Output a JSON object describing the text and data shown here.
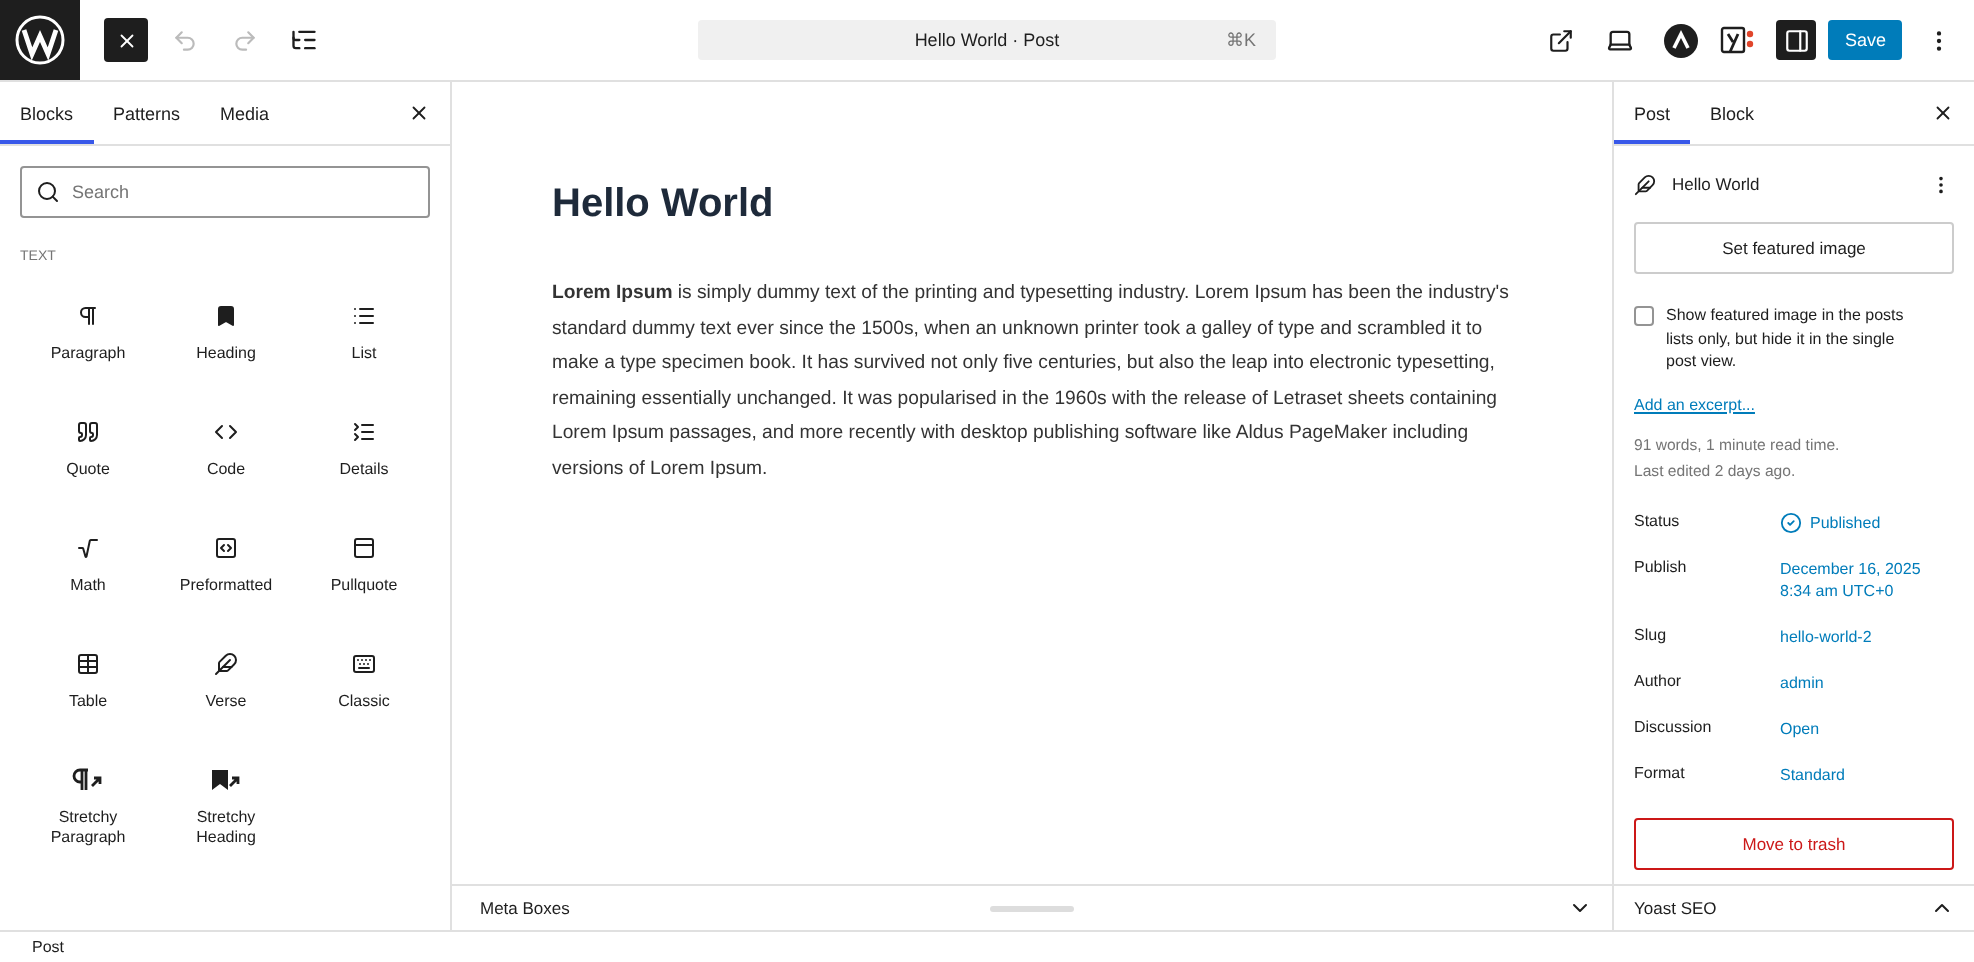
{
  "toolbar": {
    "command_bar": {
      "title": "Hello World · Post",
      "shortcut": "⌘K"
    },
    "save_label": "Save"
  },
  "inserter": {
    "tabs": [
      {
        "label": "Blocks",
        "selected": true
      },
      {
        "label": "Patterns",
        "selected": false
      },
      {
        "label": "Media",
        "selected": false
      }
    ],
    "search": {
      "placeholder": "Search"
    },
    "category": "TEXT",
    "blocks": [
      {
        "label": "Paragraph",
        "kind": "paragraph"
      },
      {
        "label": "Heading",
        "kind": "heading"
      },
      {
        "label": "List",
        "kind": "list"
      },
      {
        "label": "Quote",
        "kind": "quote"
      },
      {
        "label": "Code",
        "kind": "code"
      },
      {
        "label": "Details",
        "kind": "details"
      },
      {
        "label": "Math",
        "kind": "math"
      },
      {
        "label": "Preformatted",
        "kind": "preformatted"
      },
      {
        "label": "Pullquote",
        "kind": "pullquote"
      },
      {
        "label": "Table",
        "kind": "table"
      },
      {
        "label": "Verse",
        "kind": "verse"
      },
      {
        "label": "Classic",
        "kind": "classic"
      },
      {
        "label": "Stretchy Paragraph",
        "kind": "stretchy-paragraph"
      },
      {
        "label": "Stretchy Heading",
        "kind": "stretchy-heading"
      }
    ]
  },
  "editor": {
    "title": "Hello World",
    "body": "**Lorem Ipsum** is simply dummy text of the printing and typesetting industry. Lorem Ipsum has been the industry's standard dummy text ever since the 1500s, when an unknown printer took a galley of type and scrambled it to make a type specimen book. It has survived not only five centuries, but also the leap into electronic typesetting, remaining essentially unchanged. It was popularised in the 1960s with the release of Letraset sheets containing Lorem Ipsum passages, and more recently with desktop publishing software like Aldus PageMaker including versions of Lorem Ipsum.",
    "meta_boxes": {
      "label": "Meta Boxes",
      "expanded": false
    }
  },
  "settings": {
    "tabs": [
      {
        "label": "Post",
        "selected": true
      },
      {
        "label": "Block",
        "selected": false
      }
    ],
    "post_title": "Hello World",
    "featured_button": "Set featured image",
    "featured_option": {
      "label": "Show featured image in the posts lists only, but hide it in the single post view.",
      "checked": false
    },
    "excerpt_link": "Add an excerpt...",
    "stats": [
      "91 words, 1 minute read time.",
      "Last edited 2 days ago."
    ],
    "fields": [
      {
        "label": "Status",
        "value": "Published",
        "kind": "status"
      },
      {
        "label": "Publish",
        "value": "December 16, 2025 8:34 am UTC+0",
        "kind": "link"
      },
      {
        "label": "Slug",
        "value": "hello-world-2",
        "kind": "link"
      },
      {
        "label": "Author",
        "value": "admin",
        "kind": "link"
      },
      {
        "label": "Discussion",
        "value": "Open",
        "kind": "link"
      },
      {
        "label": "Format",
        "value": "Standard",
        "kind": "link"
      }
    ],
    "trash_button": "Move to trash",
    "yoast": {
      "label": "Yoast SEO",
      "expanded": true
    }
  },
  "footer": {
    "breadcrumb": "Post"
  }
}
